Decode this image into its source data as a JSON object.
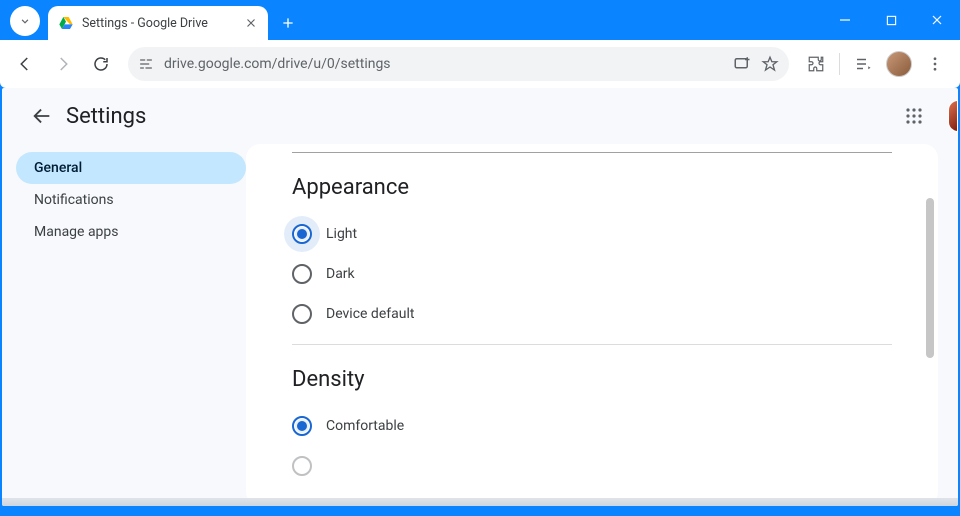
{
  "window": {
    "tab_title": "Settings - Google Drive"
  },
  "toolbar": {
    "url": "drive.google.com/drive/u/0/settings"
  },
  "drive": {
    "page_title": "Settings",
    "sidebar": {
      "items": [
        {
          "label": "General",
          "id": "general",
          "active": true
        },
        {
          "label": "Notifications",
          "id": "notifications",
          "active": false
        },
        {
          "label": "Manage apps",
          "id": "manage-apps",
          "active": false
        }
      ]
    },
    "sections": {
      "appearance": {
        "title": "Appearance",
        "options": [
          {
            "label": "Light",
            "checked": true
          },
          {
            "label": "Dark",
            "checked": false
          },
          {
            "label": "Device default",
            "checked": false
          }
        ]
      },
      "density": {
        "title": "Density",
        "options": [
          {
            "label": "Comfortable",
            "checked": true
          }
        ]
      }
    }
  }
}
